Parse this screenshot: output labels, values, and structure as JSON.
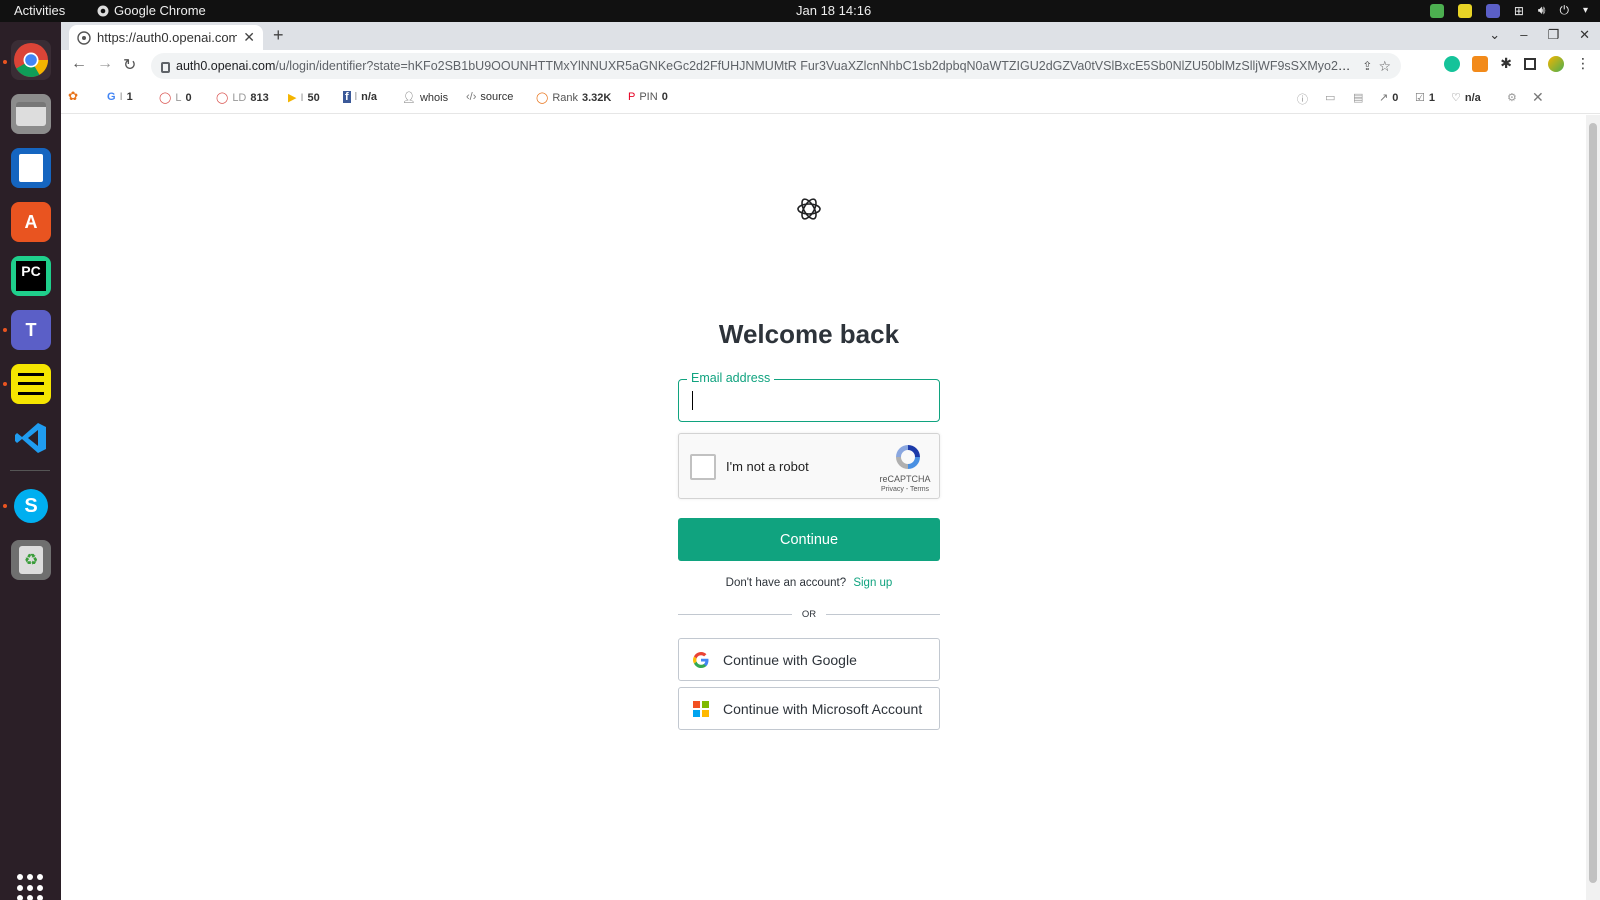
{
  "os": {
    "activities": "Activities",
    "app_name": "Google Chrome",
    "clock": "Jan 18  14:16"
  },
  "browser": {
    "tab_title": "https://auth0.openai.com",
    "url_host": "auth0.openai.com",
    "url_path": "/u/login/identifier?state=hKFo2SB1bU9OOUNHTTMxYlNNUXR5aGNKeGc2d2FfUHJNMUMtR Fur3VuaXZlcnNhbC1sb2dpbqN0aWTZIGU2dGZVa0tVSlBxcE5Sb0NlZU50blMzSlljWF9sSXMyo2NpZNkgVGRKSWN..."
  },
  "seo_toolbar": {
    "google_label": "I",
    "google_value": "1",
    "l_label": "L",
    "l_value": "0",
    "ld_label": "LD",
    "ld_value": "813",
    "bing_label": "I",
    "bing_value": "50",
    "fb_label": "l",
    "fb_value": "n/a",
    "whois": "whois",
    "source": "source",
    "rank_label": "Rank",
    "rank_value": "3.32K",
    "pin_label": "PIN",
    "pin_value": "0",
    "right_links_value": "0",
    "right_check_value": "1",
    "right_na": "n/a"
  },
  "login": {
    "heading": "Welcome back",
    "email_label": "Email address",
    "email_value": "",
    "recaptcha_label": "I'm not a robot",
    "recaptcha_brand": "reCAPTCHA",
    "recaptcha_links": "Privacy - Terms",
    "continue_label": "Continue",
    "no_account_text": "Don't have an account?",
    "signup_label": "Sign up",
    "or_text": "OR",
    "google_label": "Continue with Google",
    "microsoft_label": "Continue with Microsoft Account"
  },
  "colors": {
    "accent": "#10a37f",
    "text": "#2d333a"
  }
}
